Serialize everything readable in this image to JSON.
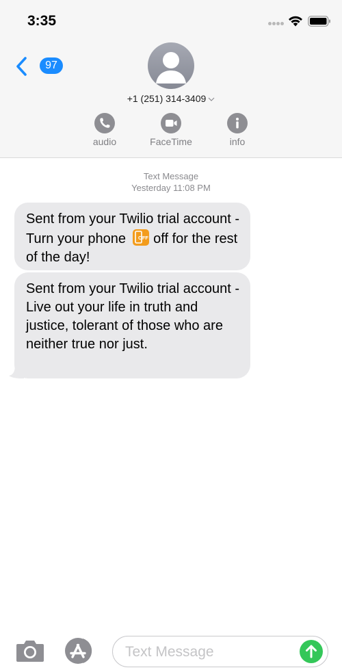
{
  "status_bar": {
    "time": "3:35"
  },
  "nav": {
    "back_badge": "97",
    "contact_number": "+1 (251) 314-3409"
  },
  "actions": [
    {
      "label": "audio",
      "icon": "phone-icon"
    },
    {
      "label": "FaceTime",
      "icon": "video-camera-icon"
    },
    {
      "label": "info",
      "icon": "info-icon"
    }
  ],
  "conversation": {
    "service": "Text Message",
    "timestamp": "Yesterday 11:08 PM",
    "messages": [
      {
        "text": "Sent from your Twilio trial account - Turn your phone off for the rest of the day!",
        "text_before_emoji": "Sent from your Twilio trial account - Turn your phone ",
        "emoji": "mobile-phone-off-emoji",
        "emoji_text": "OFF",
        "text_after_emoji": " off for the rest of the day!"
      },
      {
        "text": "Sent from your Twilio trial account - Live out your life in truth and justice, tolerant of those who are neither true nor just."
      }
    ]
  },
  "composer": {
    "placeholder": "Text Message",
    "value": ""
  },
  "colors": {
    "accent_blue": "#1a8cff",
    "incoming_bubble": "#e9e9eb",
    "send_green": "#34c759",
    "action_gray": "#8e8e93"
  }
}
